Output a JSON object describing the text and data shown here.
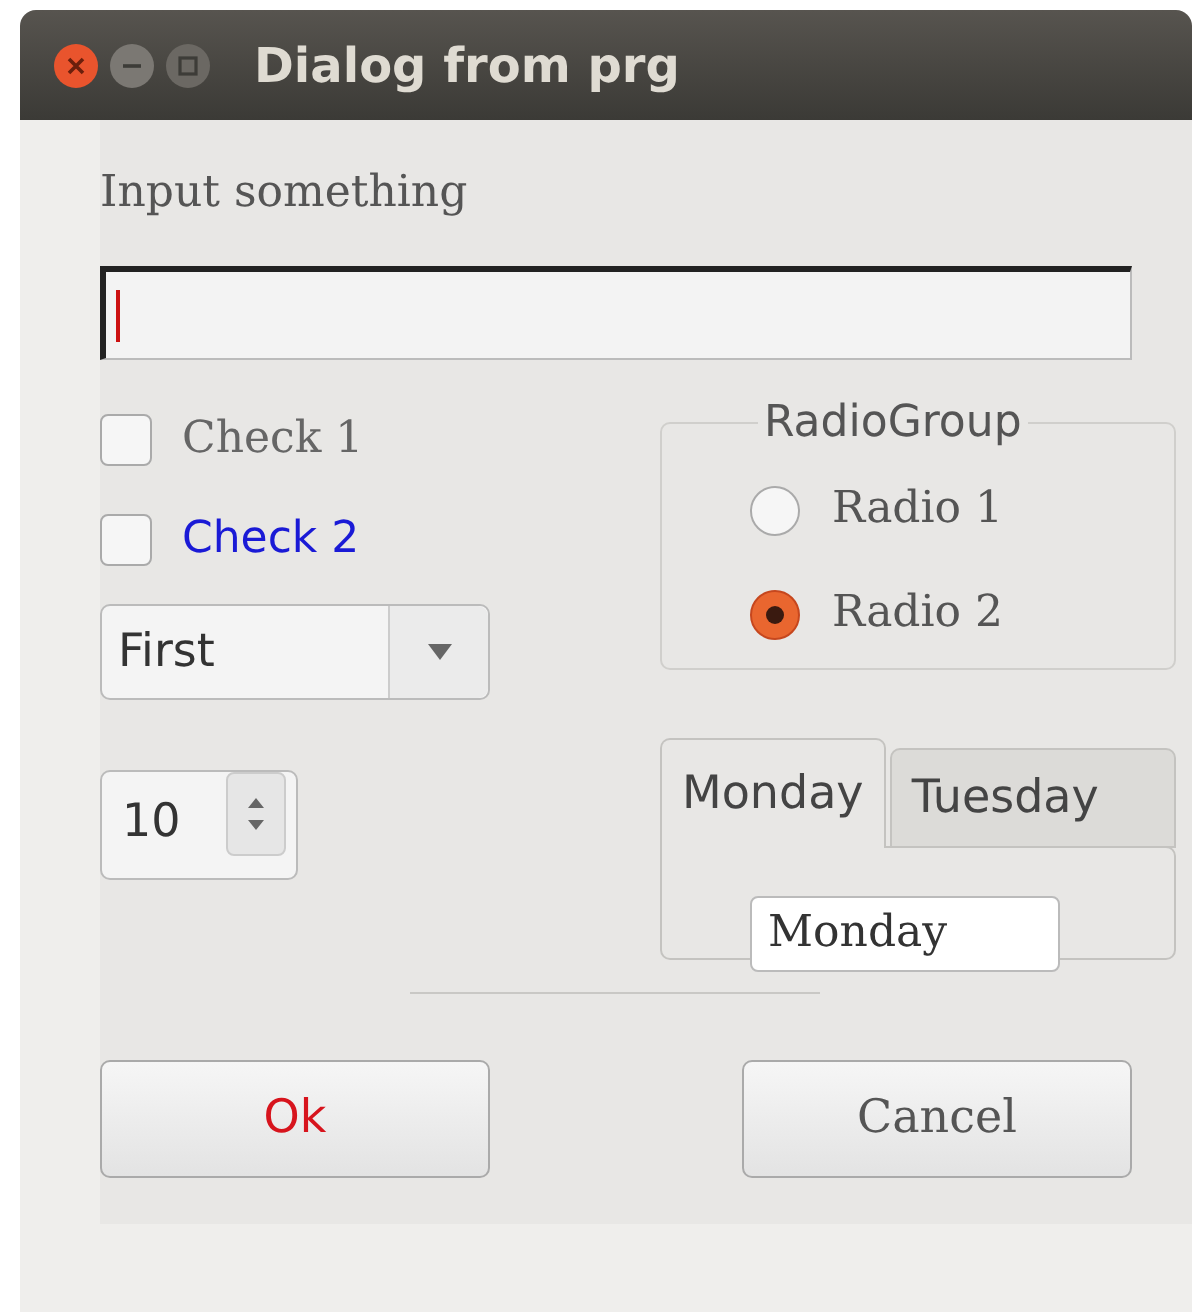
{
  "window": {
    "title": "Dialog from prg"
  },
  "input": {
    "label": "Input something",
    "focused": true
  },
  "checks": [
    {
      "label": "Check 1",
      "checked": false,
      "kind": "default"
    },
    {
      "label": "Check 2",
      "checked": false,
      "kind": "styled",
      "color": "#1a1ad6"
    }
  ],
  "combo": {
    "value": "First"
  },
  "spin": {
    "value": "10"
  },
  "radio_group": {
    "title": "RadioGroup",
    "items": [
      {
        "label": "Radio 1",
        "selected": false
      },
      {
        "label": "Radio 2",
        "selected": true
      }
    ]
  },
  "tabs": [
    {
      "label": "Monday",
      "selected": true
    },
    {
      "label": "Tuesday",
      "selected": false
    }
  ],
  "tab_content": {
    "value": "Monday"
  },
  "buttons": [
    {
      "label": "Ok",
      "kind": "styled",
      "color": "#d7141d"
    },
    {
      "label": "Cancel",
      "kind": "default"
    }
  ]
}
